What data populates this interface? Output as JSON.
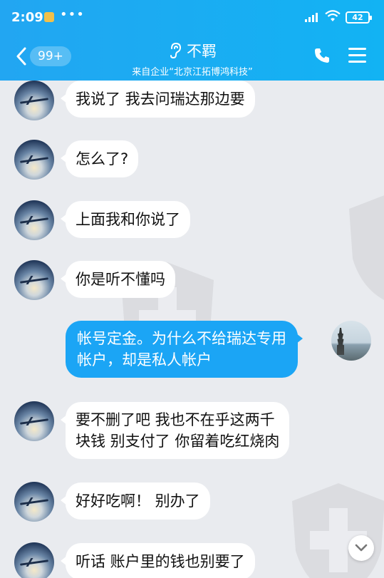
{
  "status_bar": {
    "time": "2:09",
    "dots": "•••",
    "battery": "42"
  },
  "header": {
    "unread_count": "99+",
    "contact_name": "不羁",
    "subtitle": "来自企业“北京江拓博鸿科技”"
  },
  "icons": {
    "back": "chevron-left-icon",
    "ear": "ear-icon",
    "phone": "phone-icon",
    "menu": "hamburger-menu-icon",
    "scroll": "chevron-down-icon"
  },
  "colors": {
    "header_bg": "#1aaef3",
    "chat_bg": "#e9ebef",
    "incoming_bubble": "#ffffff",
    "outgoing_bubble": "#1ba5f5"
  },
  "messages": [
    {
      "side": "in",
      "lines": [
        "我说了 我去问瑞达那边要"
      ]
    },
    {
      "side": "in",
      "lines": [
        "怎么了?"
      ]
    },
    {
      "side": "in",
      "lines": [
        " 上面我和你说了"
      ]
    },
    {
      "side": "in",
      "lines": [
        " 你是听不懂吗"
      ]
    },
    {
      "side": "out",
      "lines": [
        "帐号定金。为什么不给瑞达专用",
        "帐户，却是私人帐户"
      ]
    },
    {
      "side": "in",
      "lines": [
        " 要不删了吧  我也不在乎这两千",
        "块钱  别支付了 你留着吃红烧肉"
      ]
    },
    {
      "side": "in",
      "lines": [
        " 好好吃啊！ 别办了"
      ]
    },
    {
      "side": "in",
      "lines": [
        "听话 账户里的钱也别要了"
      ]
    }
  ]
}
